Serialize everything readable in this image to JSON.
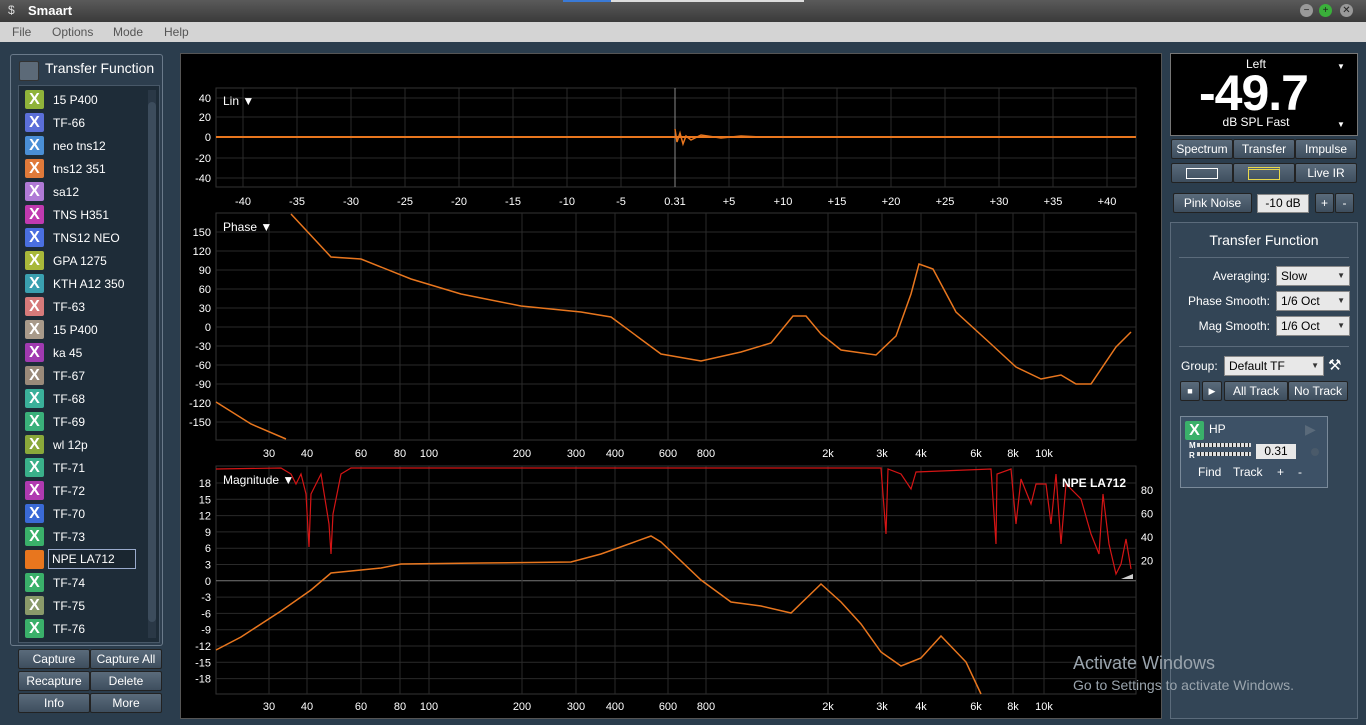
{
  "app": {
    "title": "Smaart"
  },
  "menu": [
    "File",
    "Options",
    "Mode",
    "Help"
  ],
  "left_panel": {
    "title": "Transfer Function",
    "items": [
      {
        "label": "15 P400",
        "color": "#8fb33a"
      },
      {
        "label": "TF-66",
        "color": "#5b6fd8"
      },
      {
        "label": "neo tns12",
        "color": "#4a8fd6"
      },
      {
        "label": "tns12 351",
        "color": "#e07a3a"
      },
      {
        "label": "sa12",
        "color": "#b07ad6"
      },
      {
        "label": "TNS H351",
        "color": "#c03ab0"
      },
      {
        "label": "TNS12 NEO",
        "color": "#4a6fe0"
      },
      {
        "label": "GPA 1275",
        "color": "#a8b83a"
      },
      {
        "label": "KTH A12 350",
        "color": "#3aa0b0"
      },
      {
        "label": "TF-63",
        "color": "#d67a7a"
      },
      {
        "label": "15 P400",
        "color": "#a89a8a"
      },
      {
        "label": "ka 45",
        "color": "#a03ab0"
      },
      {
        "label": "TF-67",
        "color": "#9a8a7a"
      },
      {
        "label": "TF-68",
        "color": "#3ab09a"
      },
      {
        "label": "TF-69",
        "color": "#3ab07a"
      },
      {
        "label": "wl 12p",
        "color": "#8aa83a"
      },
      {
        "label": "TF-71",
        "color": "#3ab08a"
      },
      {
        "label": "TF-72",
        "color": "#b03ab0"
      },
      {
        "label": "TF-70",
        "color": "#3a6ad6"
      },
      {
        "label": "TF-73",
        "color": "#3ab06a"
      },
      {
        "label": "NPE LA712",
        "color": "#e8761e",
        "selected": true
      },
      {
        "label": "TF-74",
        "color": "#3ab06a"
      },
      {
        "label": "TF-75",
        "color": "#8a9a6a"
      },
      {
        "label": "TF-76",
        "color": "#3ab06a"
      }
    ],
    "buttons": [
      "Capture",
      "Capture All",
      "Recapture",
      "Delete",
      "Info",
      "More"
    ]
  },
  "graph": {
    "impulse": {
      "label": "Lin ▼",
      "y_ticks": [
        "40",
        "20",
        "0",
        "-20",
        "-40"
      ],
      "x_ticks": [
        "-40",
        "-35",
        "-30",
        "-25",
        "-20",
        "-15",
        "-10",
        "-5",
        "0.31",
        "+5",
        "+10",
        "+15",
        "+20",
        "+25",
        "+30",
        "+35",
        "+40"
      ]
    },
    "phase": {
      "label": "Phase ▼",
      "y_ticks": [
        "150",
        "120",
        "90",
        "60",
        "30",
        "0",
        "-30",
        "-60",
        "-90",
        "-120",
        "-150"
      ],
      "x_ticks": [
        "30",
        "40",
        "60",
        "80",
        "100",
        "200",
        "300",
        "400",
        "600",
        "800",
        "2k",
        "3k",
        "4k",
        "6k",
        "8k",
        "10k"
      ]
    },
    "magnitude": {
      "label": "Magnitude ▼",
      "trace_name": "NPE LA712",
      "y_ticks": [
        "18",
        "15",
        "12",
        "9",
        "6",
        "3",
        "0",
        "-3",
        "-6",
        "-9",
        "-12",
        "-15",
        "-18"
      ],
      "coherence_ticks": [
        "80",
        "60",
        "40",
        "20"
      ],
      "x_ticks": [
        "30",
        "40",
        "60",
        "80",
        "100",
        "200",
        "300",
        "400",
        "600",
        "800",
        "2k",
        "3k",
        "4k",
        "6k",
        "8k",
        "10k"
      ]
    }
  },
  "spl_meter": {
    "channel": "Left",
    "value": "-49.7",
    "unit": "dB SPL Fast"
  },
  "mode_tabs": [
    "Spectrum",
    "Transfer",
    "Impulse"
  ],
  "live_ir": "Live IR",
  "generator": {
    "label": "Pink Noise",
    "level": "-10 dB",
    "plus": "+",
    "minus": "-"
  },
  "tf_settings": {
    "title": "Transfer Function",
    "averaging_label": "Averaging:",
    "averaging_value": "Slow",
    "phase_smooth_label": "Phase Smooth:",
    "phase_smooth_value": "1/6 Oct",
    "mag_smooth_label": "Mag Smooth:",
    "mag_smooth_value": "1/6 Oct",
    "group_label": "Group:",
    "group_value": "Default TF",
    "all_track": "All Track",
    "no_track": "No Track"
  },
  "measurement": {
    "name": "HP",
    "delay": "0.31",
    "m": "M",
    "r": "R",
    "find": "Find",
    "track": "Track",
    "plus": "+",
    "minus": "-"
  },
  "watermark": {
    "line1": "Activate Windows",
    "line2": "Go to Settings to activate Windows."
  }
}
